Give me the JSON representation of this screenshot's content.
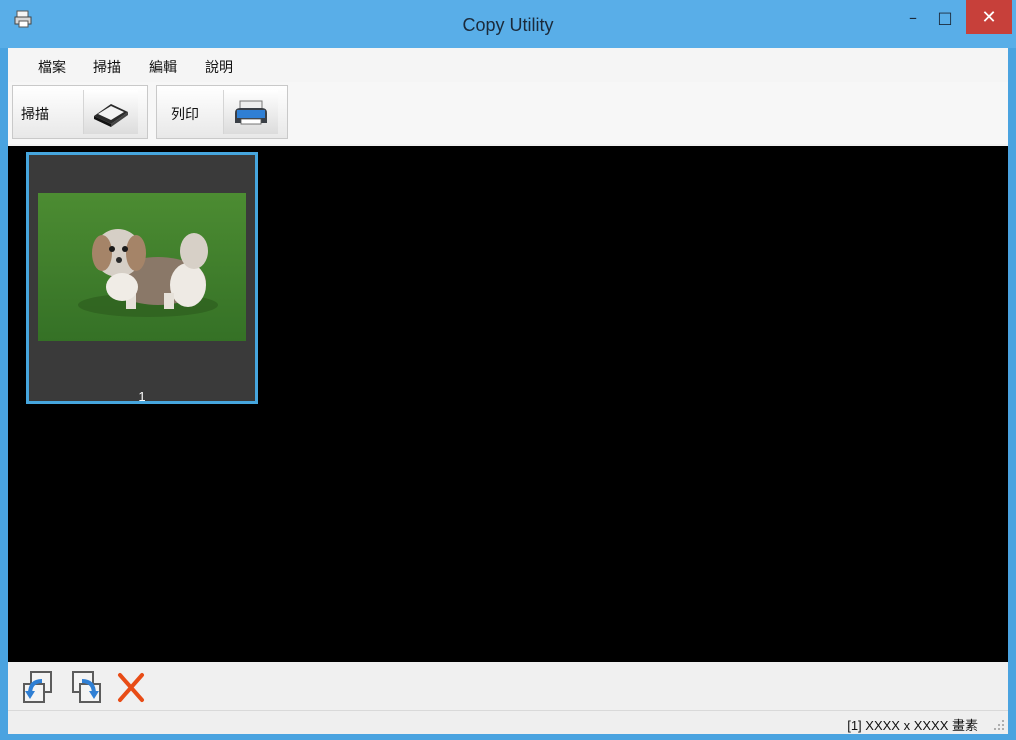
{
  "window": {
    "title": "Copy Utility",
    "minimize_glyph": "–",
    "maximize_glyph": "□",
    "close_glyph": "✕"
  },
  "menu": [
    "檔案",
    "掃描",
    "編輯",
    "說明"
  ],
  "toolbar": {
    "scan_label": "掃描",
    "print_label": "列印"
  },
  "thumbnails": [
    {
      "page_number": "1"
    }
  ],
  "status": {
    "text": "[1] XXXX x XXXX 畫素"
  },
  "colors": {
    "titlebar": "#59aee8",
    "close": "#c7403a",
    "selection": "#46a6de",
    "viewer": "#000000"
  }
}
